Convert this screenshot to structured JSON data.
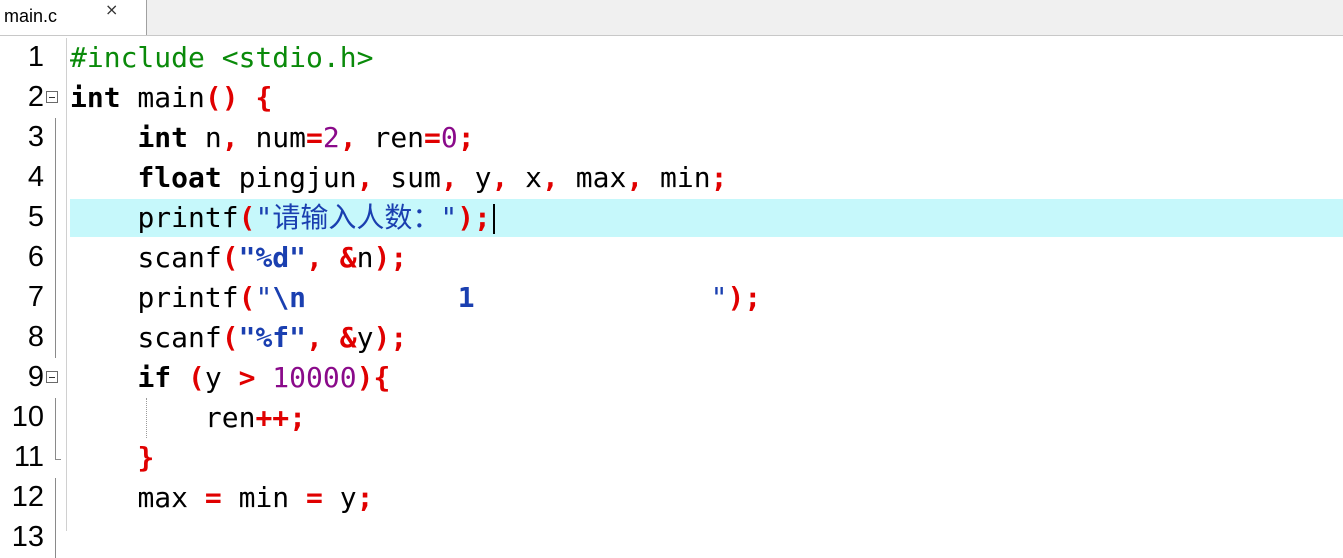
{
  "tab": {
    "label": "main.c",
    "close": "×"
  },
  "lines": [
    {
      "num": "1"
    },
    {
      "num": "2"
    },
    {
      "num": "3"
    },
    {
      "num": "4"
    },
    {
      "num": "5"
    },
    {
      "num": "6"
    },
    {
      "num": "7"
    },
    {
      "num": "8"
    },
    {
      "num": "9"
    },
    {
      "num": "10"
    },
    {
      "num": "11"
    },
    {
      "num": "12"
    },
    {
      "num": "13"
    }
  ],
  "code": {
    "l1_pp": "#include <stdio.h>",
    "l2_type": "int",
    "l2_name": " main",
    "l2_punct": "() {",
    "l3_indent": "    ",
    "l3_type": "int",
    "l3_a": " n",
    "l3_b": ",",
    "l3_c": " num",
    "l3_d": "=",
    "l3_e": "2",
    "l3_f": ",",
    "l3_g": " ren",
    "l3_h": "=",
    "l3_i": "0",
    "l3_j": ";",
    "l4_indent": "    ",
    "l4_type": "float",
    "l4_a": " pingjun",
    "l4_b": ",",
    "l4_c": " sum",
    "l4_d": ",",
    "l4_e": " y",
    "l4_f": ",",
    "l4_g": " x",
    "l4_h": ",",
    "l4_i": " max",
    "l4_j": ",",
    "l4_k": " min",
    "l4_l": ";",
    "l5_indent": "    ",
    "l5_fn": "printf",
    "l5_open": "(",
    "l5_q1": "\"",
    "l5_cjk": "请输入人数：",
    "l5_q2": "\"",
    "l5_close": ");",
    "l6_indent": "    ",
    "l6_fn": "scanf",
    "l6_open": "(",
    "l6_str": "\"%d\"",
    "l6_comma": ",",
    "l6_amp": " &",
    "l6_var": "n",
    "l6_close": ");",
    "l7_indent": "    ",
    "l7_fn": "printf",
    "l7_open": "(",
    "l7_q1": "\"",
    "l7_esc": "\\n",
    "l7_mid": "         1              ",
    "l7_q2": "\"",
    "l7_close": ");",
    "l8_indent": "    ",
    "l8_fn": "scanf",
    "l8_open": "(",
    "l8_str": "\"%f\"",
    "l8_comma": ",",
    "l8_amp": " &",
    "l8_var": "y",
    "l8_close": ");",
    "l9_indent": "    ",
    "l9_kw": "if",
    "l9_sp": " ",
    "l9_open": "(",
    "l9_var": "y ",
    "l9_gt": ">",
    "l9_num": " 10000",
    "l9_close": "){",
    "l10_indent": "        ",
    "l10_var": "ren",
    "l10_op": "++;",
    "l11_indent": "    ",
    "l11_brace": "}",
    "l12_indent": "    ",
    "l12_a": "max ",
    "l12_eq1": "=",
    "l12_b": " min ",
    "l12_eq2": "=",
    "l12_c": " y",
    "l12_semi": ";"
  }
}
